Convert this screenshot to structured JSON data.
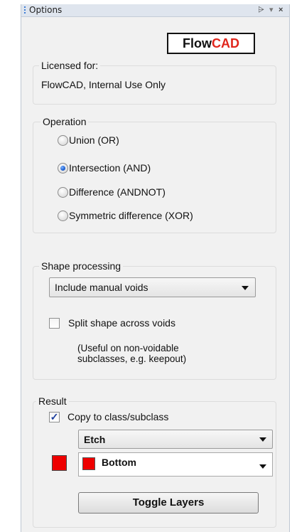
{
  "window": {
    "title": "Options",
    "pin_glyph": "⩥",
    "menu_glyph": "▾",
    "close_glyph": "×"
  },
  "logo": {
    "part1": "Flow",
    "part2": "CAD",
    "accent_color": "#e0261c"
  },
  "license": {
    "heading": "Licensed for:",
    "value": "FlowCAD, Internal Use Only"
  },
  "operation": {
    "heading": "Operation",
    "options": [
      {
        "label": "Union (OR)",
        "selected": false
      },
      {
        "label": "Intersection (AND)",
        "selected": true
      },
      {
        "label": "Difference (ANDNOT)",
        "selected": false
      },
      {
        "label": "Symmetric difference (XOR)",
        "selected": false
      }
    ]
  },
  "shape_processing": {
    "heading": "Shape processing",
    "void_mode": "Include manual voids",
    "split_label": "Split shape across voids",
    "split_checked": false,
    "note_line1": "(Useful on non-voidable",
    "note_line2": "subclasses, e.g. keepout)"
  },
  "result": {
    "heading": "Result",
    "copy_label": "Copy to class/subclass",
    "copy_checked": true,
    "check_glyph": "✓",
    "class_value": "Etch",
    "subclass_value": "Bottom",
    "layer_color": "#ee0000",
    "toggle_button": "Toggle Layers"
  }
}
